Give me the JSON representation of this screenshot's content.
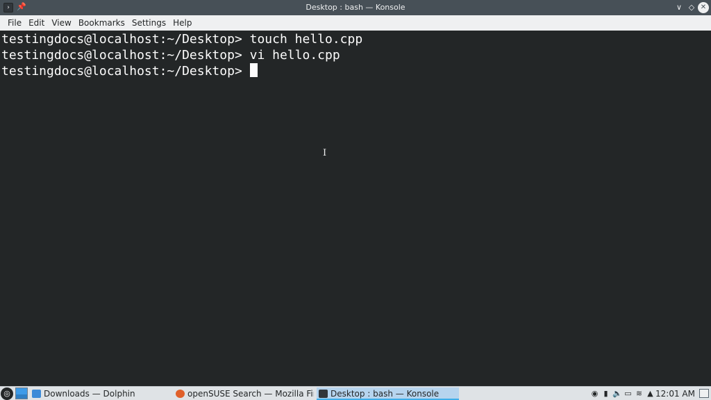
{
  "window": {
    "title": "Desktop : bash — Konsole",
    "app_icon_glyph": "›",
    "pin_glyph": "📌",
    "minimize_glyph": "∨",
    "maximize_glyph": "◇",
    "close_glyph": "✕"
  },
  "menubar": {
    "items": [
      "File",
      "Edit",
      "View",
      "Bookmarks",
      "Settings",
      "Help"
    ]
  },
  "terminal": {
    "lines": [
      "testingdocs@localhost:~/Desktop> touch hello.cpp",
      "testingdocs@localhost:~/Desktop> vi hello.cpp",
      "testingdocs@localhost:~/Desktop> "
    ],
    "ibeam_glyph": "I"
  },
  "taskbar": {
    "launcher_glyph": "◎",
    "tasks": [
      {
        "label": "Downloads — Dolphin",
        "icon": "folder-icon"
      },
      {
        "label": "openSUSE Search — Mozilla Firef...",
        "icon": "firefox-icon"
      },
      {
        "label": "Desktop : bash — Konsole",
        "icon": "konsole-icon"
      }
    ],
    "tray": {
      "clipboard_glyph": "◉",
      "battery_glyph": "▮",
      "volume_glyph": "🔈",
      "device_glyph": "▭",
      "network_glyph": "≋",
      "expand_glyph": "▲"
    },
    "clock": "12:01 AM"
  },
  "colors": {
    "titlebar": "#475057",
    "terminal_bg": "#232627",
    "terminal_fg": "#fcfcfc",
    "menubar": "#eff0f1",
    "taskbar": "#dfe3e6",
    "active_task": "#b6d4ee"
  }
}
